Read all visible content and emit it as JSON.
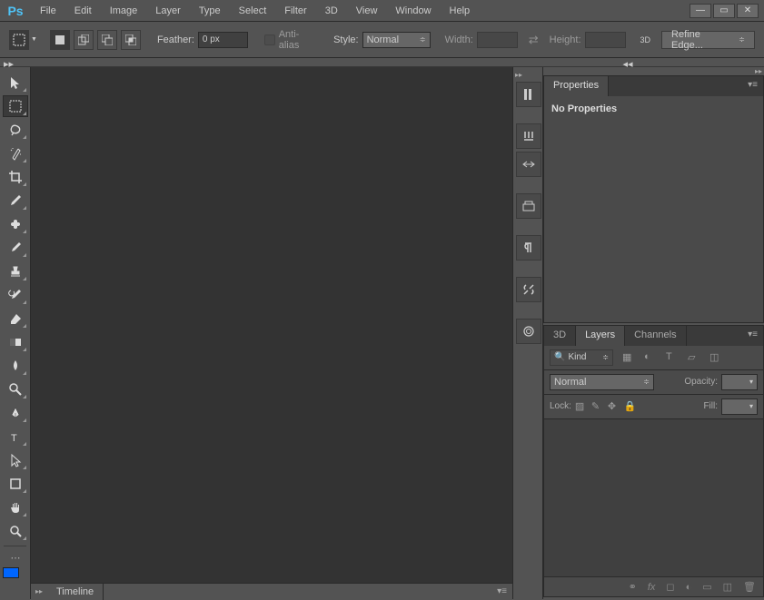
{
  "app": {
    "logo": "Ps"
  },
  "menu": [
    "File",
    "Edit",
    "Image",
    "Layer",
    "Type",
    "Select",
    "Filter",
    "3D",
    "View",
    "Window",
    "Help"
  ],
  "options": {
    "feather_label": "Feather:",
    "feather_value": "0 px",
    "antialias_label": "Anti-alias",
    "style_label": "Style:",
    "style_value": "Normal",
    "width_label": "Width:",
    "height_label": "Height:",
    "threeD_label": "3D",
    "refine_label": "Refine Edge..."
  },
  "timeline": {
    "label": "Timeline"
  },
  "panels": {
    "properties": {
      "tab": "Properties",
      "body": "No Properties"
    },
    "layers": {
      "tabs": [
        "3D",
        "Layers",
        "Channels"
      ],
      "filter_value": "Kind",
      "blend_value": "Normal",
      "opacity_label": "Opacity:",
      "lock_label": "Lock:",
      "fill_label": "Fill:"
    }
  },
  "tools": [
    "move",
    "marquee",
    "lasso",
    "magic-wand",
    "crop",
    "eyedropper",
    "healing",
    "brush",
    "stamp",
    "history-brush",
    "eraser",
    "gradient",
    "blur",
    "dodge",
    "pen",
    "type",
    "path-select",
    "rectangle",
    "hand",
    "zoom"
  ],
  "strip": [
    "history",
    "color",
    "brushes-panel",
    "layers-panel",
    "paragraph",
    "tools-panel",
    "cloud"
  ]
}
